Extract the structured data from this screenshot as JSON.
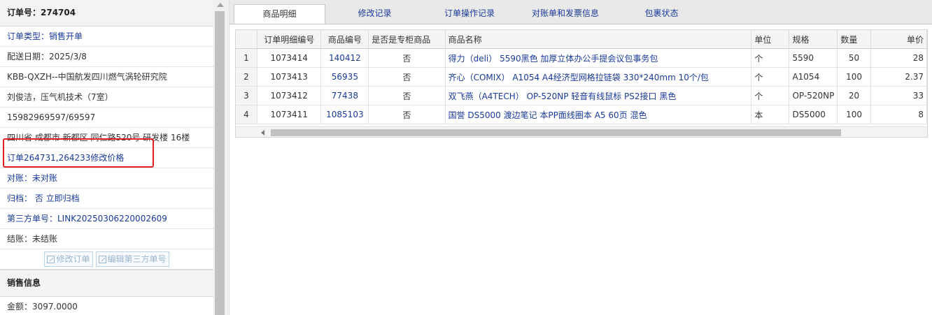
{
  "left": {
    "header": "订单号：274704",
    "rows": [
      {
        "label": "订单类型：销售开单"
      },
      {
        "label": "配送日期：2025/3/8"
      },
      {
        "label": "KBB-QXZH--中国航发四川燃气涡轮研究院"
      },
      {
        "label": "刘俊洁，压气机技术（7室）"
      },
      {
        "label": "15982969597/69597"
      },
      {
        "label": "四川省 成都市 新都区 同仁路520号 研发楼 16楼"
      },
      {
        "label": "订单264731,264233修改价格"
      },
      {
        "label": "对账：未对账"
      },
      {
        "label": "归档： 否 立即归档"
      },
      {
        "label": "第三方单号：LINK20250306220002609"
      },
      {
        "label": "结账：未结账"
      }
    ],
    "buttons": {
      "edit_order": "修改订单",
      "edit_third": "编辑第三方单号"
    },
    "sales_header": "销售信息",
    "amount": "金额：3097.0000"
  },
  "tabs": [
    {
      "label": "商品明细"
    },
    {
      "label": "修改记录"
    },
    {
      "label": "订单操作记录"
    },
    {
      "label": "对账单和发票信息"
    },
    {
      "label": "包裹状态"
    }
  ],
  "table": {
    "columns": [
      "",
      "订单明细编号",
      "商品编号",
      "是否是专柜商品",
      "商品名称",
      "单位",
      "规格",
      "数量",
      "单价"
    ],
    "rows": [
      {
        "n": "1",
        "detail_id": "1073414",
        "product_id": "140412",
        "counter": "否",
        "name": "得力（deli） 5590黑色 加厚立体办公手提会议包事务包",
        "unit": "个",
        "spec": "5590",
        "qty": "50",
        "price": "28"
      },
      {
        "n": "2",
        "detail_id": "1073413",
        "product_id": "56935",
        "counter": "否",
        "name": "齐心（COMIX） A1054 A4经济型网格拉链袋 330*240mm 10个/包",
        "unit": "个",
        "spec": "A1054",
        "qty": "100",
        "price": "2.37"
      },
      {
        "n": "3",
        "detail_id": "1073412",
        "product_id": "77438",
        "counter": "否",
        "name": "双飞燕（A4TECH） OP-520NP 轻音有线鼠标 PS2接口 黑色",
        "unit": "个",
        "spec": "OP-520NP",
        "qty": "20",
        "price": "33"
      },
      {
        "n": "4",
        "detail_id": "1073411",
        "product_id": "1085103",
        "counter": "否",
        "name": "国誉 DS5000 渡边笔记 本PP面线圈本 A5 60页 混色",
        "unit": "本",
        "spec": "DS5000",
        "qty": "100",
        "price": "8"
      }
    ]
  },
  "colors": {
    "link": "#1a3a9a",
    "highlight_border": "#e02020"
  }
}
